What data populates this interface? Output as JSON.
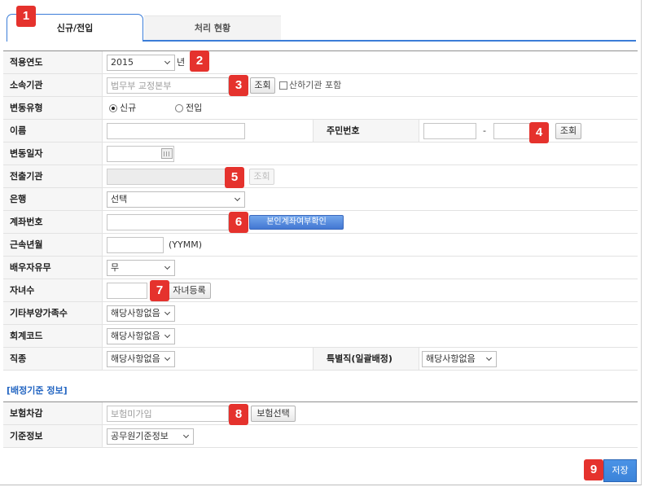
{
  "tabs": [
    {
      "label": "신규/전입",
      "active": true
    },
    {
      "label": "처리 현황",
      "active": false
    }
  ],
  "step_badges": [
    "1",
    "2",
    "3",
    "4",
    "5",
    "6",
    "7",
    "8",
    "9"
  ],
  "form": {
    "apply_year": {
      "label": "적용연도",
      "value": "2015",
      "suffix": "년"
    },
    "agency": {
      "label": "소속기관",
      "value": "법무부 교정본부",
      "search_button": "조회",
      "include_sub": {
        "label": "산하기관 포함",
        "checked": false
      }
    },
    "change_type": {
      "label": "변동유형",
      "options": [
        {
          "label": "신규",
          "checked": true
        },
        {
          "label": "전입",
          "checked": false
        }
      ]
    },
    "name": {
      "label": "이름",
      "value": ""
    },
    "rrn": {
      "label": "주민번호",
      "front": "",
      "separator": "-",
      "back": "",
      "search_button": "조회"
    },
    "change_date": {
      "label": "변동일자",
      "value": ""
    },
    "origin_agency": {
      "label": "전출기관",
      "value": "",
      "search_button": "조회"
    },
    "bank": {
      "label": "은행",
      "value": "선택"
    },
    "account_number": {
      "label": "계좌번호",
      "value": "",
      "verify_button": "본인계좌여부확인"
    },
    "service_period": {
      "label": "근속년월",
      "value": "",
      "hint": "(YYMM)"
    },
    "spouse": {
      "label": "배우자유무",
      "value": "무"
    },
    "children": {
      "label": "자녀수",
      "value": "",
      "register_button": "자녀등록"
    },
    "other_dependents": {
      "label": "기타부양가족수",
      "value": "해당사항없음"
    },
    "accounting_code": {
      "label": "회계코드",
      "value": "해당사항없음"
    },
    "job_type": {
      "label": "직종",
      "value": "해당사항없음"
    },
    "special_job": {
      "label": "특별직(일괄배정)",
      "value": "해당사항없음"
    }
  },
  "allocation": {
    "heading": "[배정기준 정보]",
    "insurance": {
      "label": "보험차감",
      "value": "보험미가입",
      "select_button": "보험선택"
    },
    "criteria": {
      "label": "기준정보",
      "value": "공무원기준정보"
    }
  },
  "save_button": "저장",
  "colors": {
    "accent": "#3b7dd8",
    "badge": "#e5322d",
    "section_heading": "#2466c2",
    "primary_button": "#3b83d9"
  },
  "icons": {
    "dropdown": "chevron-down-icon",
    "calendar": "calendar-icon"
  }
}
